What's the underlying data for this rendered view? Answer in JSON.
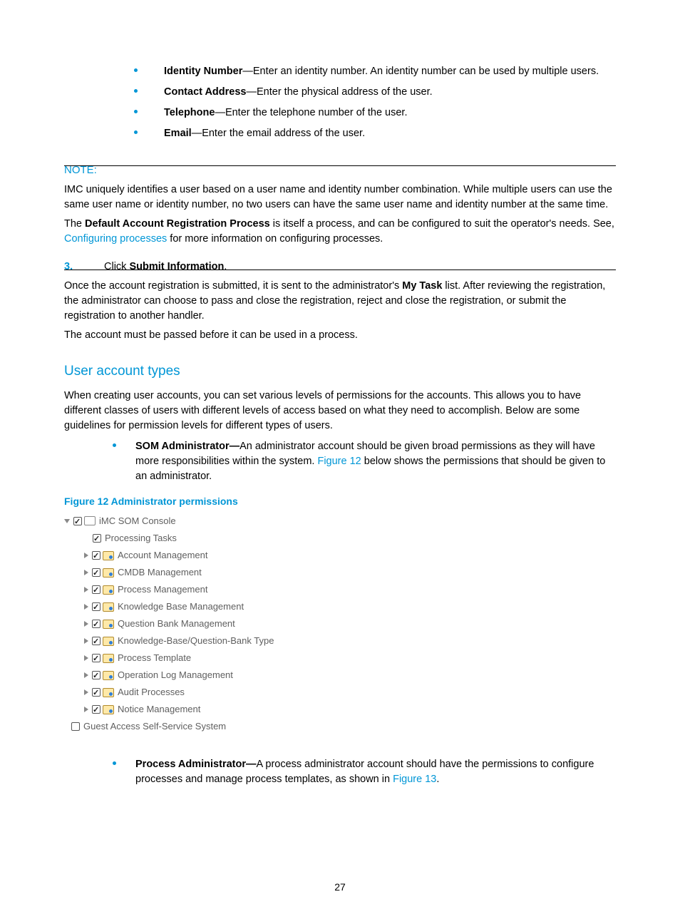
{
  "definitions": [
    {
      "term": "Identity Number",
      "desc": "—Enter an identity number. An identity number can be used by multiple users."
    },
    {
      "term": "Contact Address",
      "desc": "—Enter the physical address of the user."
    },
    {
      "term": "Telephone",
      "desc": "—Enter the telephone number of the user."
    },
    {
      "term": "Email",
      "desc": "—Enter the email address of the user."
    }
  ],
  "note": {
    "heading": "NOTE:",
    "body": "IMC uniquely identifies a user based on a user name and identity number combination. While multiple users can use the same user name or identity number, no two users can have the same user name and identity number at the same time.",
    "darp_pre": "The ",
    "darp_bold": "Default Account Registration Process",
    "darp_mid": " is itself a process, and can be configured to suit the operator's needs. See, ",
    "darp_link": "Configuring processes",
    "darp_post": " for more information on configuring processes."
  },
  "step3": {
    "num": "3.",
    "click_pre": "Click ",
    "click_bold": "Submit Information",
    "click_post": ".",
    "p1_pre": "Once the account registration is submitted, it is sent to the administrator's ",
    "p1_bold": "My Task",
    "p1_post": " list. After reviewing the registration, the administrator can choose to pass and close the registration, reject and close the registration, or submit the registration to another handler.",
    "p2": "The account must be passed before it can be used in a process."
  },
  "section": {
    "heading": "User account types",
    "intro": "When creating user accounts, you can set various levels of permissions for the accounts. This allows you to have different classes of users with different levels of access based on what they need to accomplish. Below are some guidelines for permission levels for different types of users."
  },
  "som_admin": {
    "term": "SOM Administrator—",
    "pre": "An administrator account should be given broad permissions as they will have more responsibilities within the system. ",
    "link": "Figure 12",
    "post": " below shows the permissions that should be given to an administrator."
  },
  "figure12_caption": "Figure 12 Administrator permissions",
  "tree": {
    "root": "iMC SOM Console",
    "leaf1": "Processing Tasks",
    "items": [
      "Account Management",
      "CMDB Management",
      "Process Management",
      "Knowledge Base Management",
      "Question Bank Management",
      "Knowledge-Base/Question-Bank Type",
      "Process Template",
      "Operation Log Management",
      "Audit Processes",
      "Notice Management"
    ],
    "guest": "Guest Access Self-Service System"
  },
  "proc_admin": {
    "term": "Process Administrator—",
    "pre": "A process administrator account should have the permissions to configure processes and manage process templates, as shown in ",
    "link": "Figure 13",
    "post": "."
  },
  "page_number": "27"
}
